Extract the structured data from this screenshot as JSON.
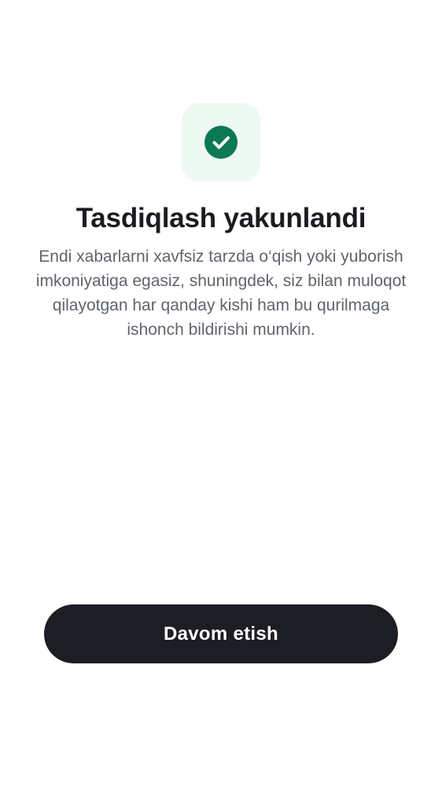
{
  "confirmation": {
    "icon": "check-circle-icon",
    "icon_color": "#0a7a55",
    "tile_color": "#eff9f3",
    "title": "Tasdiqlash yakunlandi",
    "description": "Endi xabarlarni xavfsiz tarzda o‘qish yoki yuborish imkoniyatiga egasiz, shuningdek, siz bilan muloqot qilayotgan har qanday kishi ham bu qurilmaga ishonch bildirishi mumkin."
  },
  "actions": {
    "continue_label": "Davom etish",
    "button_color": "#1c1e23"
  }
}
